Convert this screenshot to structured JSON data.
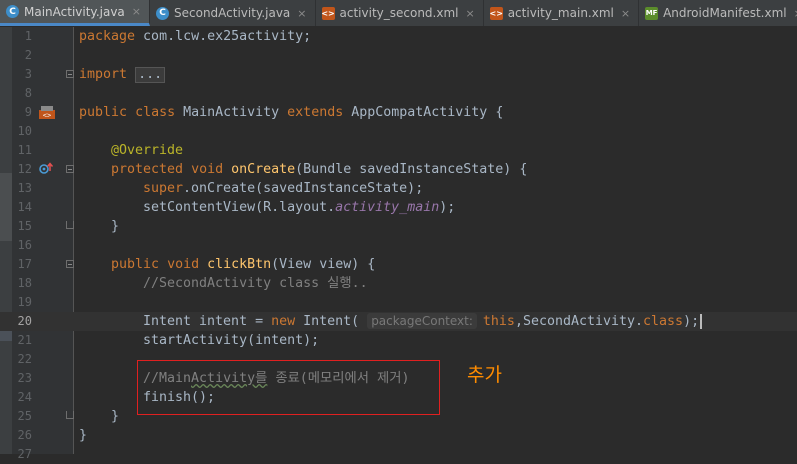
{
  "tabs": [
    {
      "label": "MainActivity.java",
      "icon": "class-icon",
      "active": true
    },
    {
      "label": "SecondActivity.java",
      "icon": "class-icon",
      "active": false
    },
    {
      "label": "activity_second.xml",
      "icon": "xml-icon",
      "active": false
    },
    {
      "label": "activity_main.xml",
      "icon": "xml-icon",
      "active": false
    },
    {
      "label": "AndroidManifest.xml",
      "icon": "manifest-icon",
      "active": false
    }
  ],
  "tab_close_glyph": "×",
  "line_numbers": [
    "1",
    "2",
    "3",
    "8",
    "9",
    "10",
    "11",
    "12",
    "13",
    "14",
    "15",
    "16",
    "17",
    "18",
    "19",
    "20",
    "21",
    "22",
    "23",
    "24",
    "25",
    "26",
    "27"
  ],
  "code": {
    "l1_kw": "package",
    "l1_rest": " com.lcw.ex25activity;",
    "l3_kw": "import",
    "l3_fold": "...",
    "l9_kw1": "public",
    "l9_kw2": "class",
    "l9_name": " MainActivity ",
    "l9_kw3": "extends",
    "l9_rest": " AppCompatActivity {",
    "l11_ann": "@Override",
    "l12_kw1": "protected",
    "l12_kw2": "void",
    "l12_fn": "onCreate",
    "l12_rest": "(Bundle savedInstanceState) {",
    "l13_kw": "super",
    "l13_rest": ".onCreate(savedInstanceState);",
    "l14_a": "setContentView(R.layout.",
    "l14_it": "activity_main",
    "l14_b": ");",
    "l15": "}",
    "l17_kw1": "public",
    "l17_kw2": "void",
    "l17_fn": "clickBtn",
    "l17_rest": "(View view) {",
    "l18_cm": "//SecondActivity class 실행..",
    "l20_a": "Intent intent = ",
    "l20_kw": "new",
    "l20_b": " Intent(",
    "l20_hint": "packageContext:",
    "l20_kw2": "this",
    "l20_c": ",SecondActivity.",
    "l20_kw3": "class",
    "l20_d": ");",
    "l21": "startActivity(intent);",
    "l23_cm1": "//Main",
    "l23_sq": "Activity를",
    "l23_cm2": " 종료(메모리에서 제거)",
    "l24": "finish();",
    "l25": "}",
    "l26": "}"
  },
  "annotation_note": "추가",
  "colors": {
    "background": "#2b2b2b",
    "keyword": "#cc7832",
    "function": "#ffc66d",
    "annotation": "#bbb529",
    "comment": "#808080",
    "field": "#9876aa",
    "highlight_box": "#e02020",
    "note": "#ff8c00"
  }
}
